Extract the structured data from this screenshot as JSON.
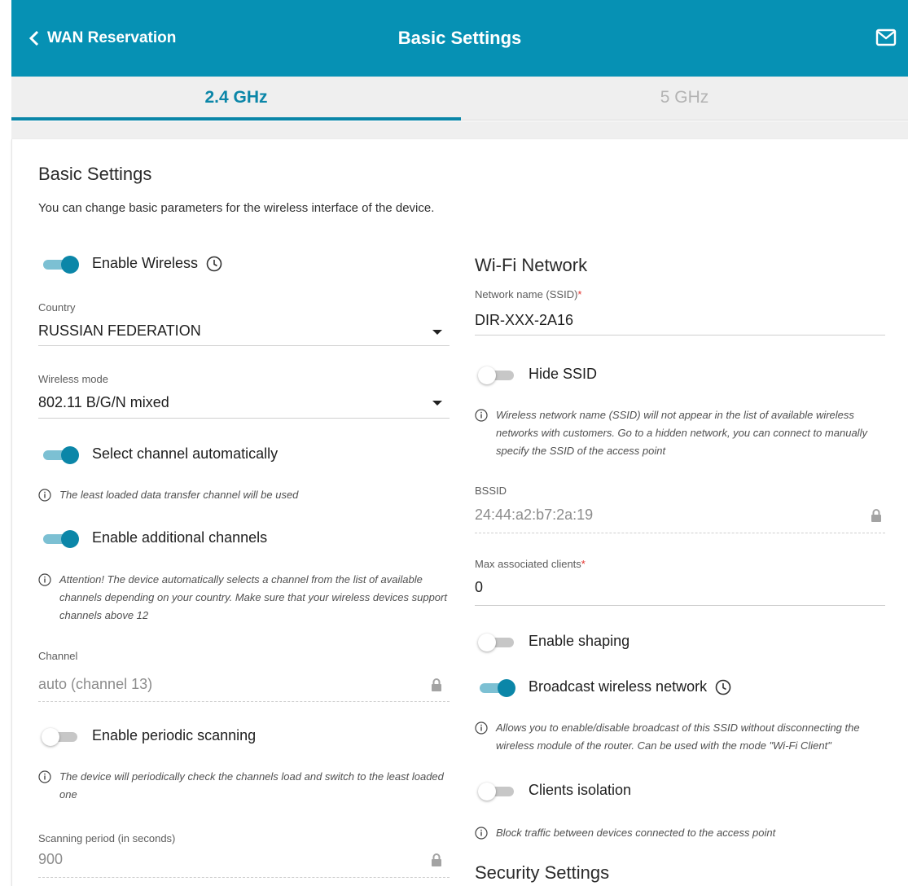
{
  "header": {
    "back_label": "WAN Reservation",
    "title": "Basic Settings"
  },
  "tabs": [
    {
      "label": "2.4 GHz",
      "active": true
    },
    {
      "label": "5 GHz",
      "active": false
    }
  ],
  "page": {
    "title": "Basic Settings",
    "description": "You can change basic parameters for the wireless interface of the device."
  },
  "left": {
    "enable_wireless": {
      "label": "Enable Wireless",
      "on": true
    },
    "country": {
      "label": "Country",
      "value": "RUSSIAN FEDERATION"
    },
    "wireless_mode": {
      "label": "Wireless mode",
      "value": "802.11 B/G/N mixed"
    },
    "select_channel_auto": {
      "label": "Select channel automatically",
      "on": true
    },
    "select_channel_note": "The least loaded data transfer channel will be used",
    "additional_channels": {
      "label": "Enable additional channels",
      "on": true
    },
    "additional_channels_note": "Attention! The device automatically selects a channel from the list of available channels depending on your country. Make sure that your wireless devices support channels above 12",
    "channel": {
      "label": "Channel",
      "value": "auto (channel 13)"
    },
    "periodic_scanning": {
      "label": "Enable periodic scanning",
      "on": false
    },
    "periodic_scanning_note": "The device will periodically check the channels load and switch to the least loaded one",
    "scanning_period": {
      "label": "Scanning period (in seconds)",
      "value": "900"
    }
  },
  "right": {
    "wifi_title": "Wi-Fi Network",
    "ssid": {
      "label": "Network name (SSID)",
      "required_mark": "*",
      "value": "DIR-XXX-2A16"
    },
    "hide_ssid": {
      "label": "Hide SSID",
      "on": false
    },
    "hide_ssid_note": "Wireless network name (SSID) will not appear in the list of available wireless networks with customers. Go to a hidden network, you can connect to manually specify the SSID of the access point",
    "bssid": {
      "label": "BSSID",
      "value": "24:44:a2:b7:2a:19"
    },
    "max_clients": {
      "label": "Max associated clients",
      "required_mark": "*",
      "value": "0"
    },
    "enable_shaping": {
      "label": "Enable shaping",
      "on": false
    },
    "broadcast": {
      "label": "Broadcast wireless network",
      "on": true
    },
    "broadcast_note": "Allows you to enable/disable broadcast of this SSID without disconnecting the wireless module of the router. Can be used with the mode \"Wi-Fi Client\"",
    "clients_isolation": {
      "label": "Clients isolation",
      "on": false
    },
    "clients_isolation_note": "Block traffic between devices connected to the access point",
    "security_title": "Security Settings"
  },
  "colors": {
    "header_bg": "#0691b4",
    "accent": "#0b86a8",
    "switch_track_on": "#7cc0d3",
    "required": "#e3342f"
  },
  "icons": [
    "chevron-left-icon",
    "mail-icon",
    "clock-icon",
    "info-icon",
    "lock-icon",
    "caret-down-icon"
  ]
}
